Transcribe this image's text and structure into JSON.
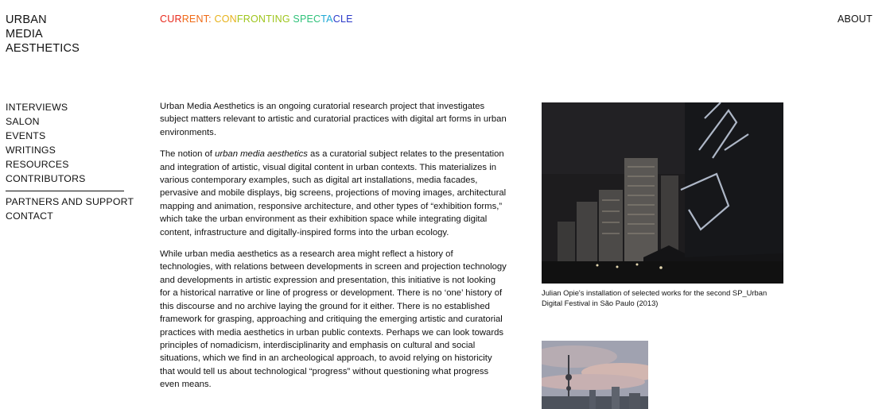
{
  "header": {
    "logo_lines": [
      "URBAN",
      "MEDIA",
      "AESTHETICS"
    ],
    "current_parts": [
      {
        "text": "CUR",
        "color": "#e8281b"
      },
      {
        "text": "RENT: ",
        "color": "#f06a15"
      },
      {
        "text": "CON",
        "color": "#e7b21b"
      },
      {
        "text": "FRONTING ",
        "color": "#9ec51c"
      },
      {
        "text": "SPEC",
        "color": "#2fc27a"
      },
      {
        "text": "TA",
        "color": "#1fa9d6"
      },
      {
        "text": "CLE",
        "color": "#2b39c9"
      }
    ],
    "about_label": "ABOUT"
  },
  "nav": {
    "primary": [
      "INTERVIEWS",
      "SALON",
      "EVENTS",
      "WRITINGS",
      "RESOURCES",
      "CONTRIBUTORS"
    ],
    "secondary": [
      "PARTNERS AND SUPPORT",
      "CONTACT"
    ]
  },
  "main": {
    "p1": "Urban Media Aesthetics is an ongoing curatorial research project that investigates subject matters relevant to artistic and curatorial practices with digital art forms in urban environments.",
    "p2_before": "The notion of ",
    "p2_em": "urban media aesthetics",
    "p2_after": " as a curatorial subject relates to the presentation and integration of artistic, visual digital content in urban contexts. This materializes in various contemporary examples, such as digital art installations, media facades, pervasive and mobile displays, big screens, projections of moving images, architectural mapping and animation, responsive architecture, and other types of “exhibition forms,” which take the urban environment as their exhibition space while integrating digital content, infrastructure and digitally-inspired forms into the urban ecology.",
    "p3": "While urban media aesthetics as a research area might reflect a history of technologies, with relations between developments in screen and projection technology and developments in artistic expression and presentation, this initiative is not looking for a historical narrative or line of progress or development. There is no ‘one’ history of this discourse and no archive laying the ground for it either. There is no established framework for grasping, approaching and critiquing the emerging artistic and curatorial practices with media aesthetics in urban public contexts. Perhaps we can look towards principles of nomadicism, interdisciplinarity and emphasis on cultural and social situations, which we find in an archeological approach, to avoid relying on historicity that would tell us about technological “progress” without questioning what progress even means."
  },
  "media": {
    "caption1": "Julian Opie's installation of selected works for the second SP_Urban Digital Festival in São Paulo (2013)"
  }
}
